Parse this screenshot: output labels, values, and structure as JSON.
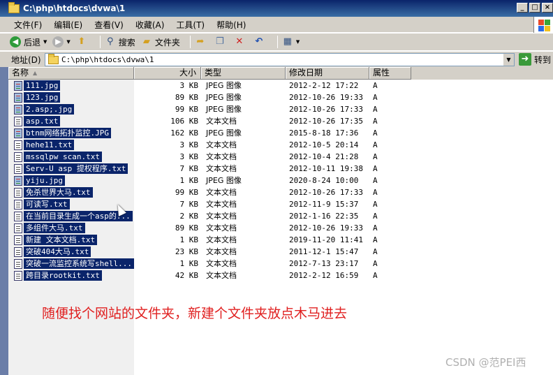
{
  "window": {
    "title": "C:\\php\\htdocs\\dvwa\\1"
  },
  "menu": [
    "文件(F)",
    "编辑(E)",
    "查看(V)",
    "收藏(A)",
    "工具(T)",
    "帮助(H)"
  ],
  "toolbar": {
    "back": "后退",
    "search": "搜索",
    "folders": "文件夹"
  },
  "address": {
    "label": "地址(D)",
    "value": "C:\\php\\htdocs\\dvwa\\1",
    "go": "转到"
  },
  "columns": {
    "name": "名称",
    "size": "大小",
    "type": "类型",
    "modified": "修改日期",
    "attributes": "属性"
  },
  "files": [
    {
      "name": "111.jpg",
      "size": "3 KB",
      "type": "JPEG 图像",
      "modified": "2012-2-12 17:22",
      "attr": "A",
      "icon": "image-file-icon"
    },
    {
      "name": "123.jpg",
      "size": "89 KB",
      "type": "JPEG 图像",
      "modified": "2012-10-26 19:33",
      "attr": "A",
      "icon": "image-file-icon"
    },
    {
      "name": "2.asp;.jpg",
      "size": "99 KB",
      "type": "JPEG 图像",
      "modified": "2012-10-26 17:33",
      "attr": "A",
      "icon": "image-file-icon"
    },
    {
      "name": "asp.txt",
      "size": "106 KB",
      "type": "文本文档",
      "modified": "2012-10-26 17:35",
      "attr": "A",
      "icon": "text-file-icon"
    },
    {
      "name": "btnm网络拓扑监控.JPG",
      "size": "162 KB",
      "type": "JPEG 图像",
      "modified": "2015-8-18 17:36",
      "attr": "A",
      "icon": "image-file-icon"
    },
    {
      "name": "hehe11.txt",
      "size": "3 KB",
      "type": "文本文档",
      "modified": "2012-10-5 20:14",
      "attr": "A",
      "icon": "text-file-icon"
    },
    {
      "name": "mssqlpw scan.txt",
      "size": "3 KB",
      "type": "文本文档",
      "modified": "2012-10-4 21:28",
      "attr": "A",
      "icon": "text-file-icon"
    },
    {
      "name": "Serv-U asp 提权程序.txt",
      "size": "7 KB",
      "type": "文本文档",
      "modified": "2012-10-11 19:38",
      "attr": "A",
      "icon": "text-file-icon"
    },
    {
      "name": "yiju.jpg",
      "size": "1 KB",
      "type": "JPEG 图像",
      "modified": "2020-8-24 10:00",
      "attr": "A",
      "icon": "image-file-icon"
    },
    {
      "name": "免杀世界大马.txt",
      "size": "99 KB",
      "type": "文本文档",
      "modified": "2012-10-26 17:33",
      "attr": "A",
      "icon": "text-file-icon"
    },
    {
      "name": "可读写.txt",
      "size": "7 KB",
      "type": "文本文档",
      "modified": "2012-11-9 15:37",
      "attr": "A",
      "icon": "text-file-icon"
    },
    {
      "name": "在当前目录生成一个asp的...",
      "size": "2 KB",
      "type": "文本文档",
      "modified": "2012-1-16 22:35",
      "attr": "A",
      "icon": "text-file-icon"
    },
    {
      "name": "多组件大马.txt",
      "size": "89 KB",
      "type": "文本文档",
      "modified": "2012-10-26 19:33",
      "attr": "A",
      "icon": "text-file-icon"
    },
    {
      "name": "新建 文本文档.txt",
      "size": "1 KB",
      "type": "文本文档",
      "modified": "2019-11-20 11:41",
      "attr": "A",
      "icon": "text-file-icon"
    },
    {
      "name": "突破404大马.txt",
      "size": "23 KB",
      "type": "文本文档",
      "modified": "2011-12-1 15:47",
      "attr": "A",
      "icon": "text-file-icon"
    },
    {
      "name": "突破一流监控系统写shell...",
      "size": "1 KB",
      "type": "文本文档",
      "modified": "2012-7-13 23:17",
      "attr": "A",
      "icon": "text-file-icon"
    },
    {
      "name": "跨目录rootkit.txt",
      "size": "42 KB",
      "type": "文本文档",
      "modified": "2012-2-12 16:59",
      "attr": "A",
      "icon": "text-file-icon"
    }
  ],
  "annotation": "随便找个网站的文件夹，新建个文件夹放点木马进去",
  "watermark": "CSDN @范PEI西",
  "colors": {
    "titlebar": "#0a246a",
    "selection": "#0a246a",
    "annotation": "#e02020",
    "chrome": "#d4d0c8"
  }
}
